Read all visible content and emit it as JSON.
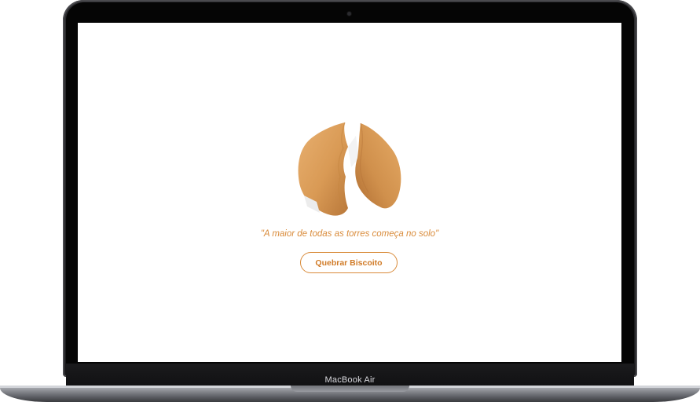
{
  "device": {
    "label": "MacBook Air"
  },
  "app": {
    "fortune_text": "\"A maior de todas as torres começa no solo\"",
    "button_label": "Quebrar Biscoito",
    "accent_color": "#d98b3a",
    "image_icon": "broken-fortune-cookie-icon"
  }
}
